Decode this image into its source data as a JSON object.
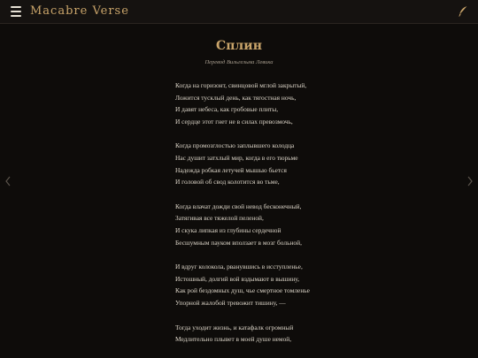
{
  "header": {
    "brand": "Macabre Verse",
    "menu_icon": "hamburger-menu-icon",
    "write_icon": "quill-icon"
  },
  "poem": {
    "title": "Сплин",
    "subtitle": "Перевод Вильгельма Левика",
    "stanzas": [
      [
        "Когда на горизонт, свинцовой мглой закрытый,",
        "Ложится тусклый день, как тягостная ночь,",
        "И давят небеса, как гробовые плиты,",
        "И сердце этот гнет не в силах превозмочь,"
      ],
      [
        "Когда промозглостью заплывшего колодца",
        "Нас душит затхлый мир, когда в его тюрьме",
        "Надежда робкая летучей мышью бьется",
        "И головой об свод колотится во тьме,"
      ],
      [
        "Когда влачат дожди свой невод бесконечный,",
        "Затягивая все тяжелой пеленой,",
        "И скука липкая из глубины сердечной",
        "Бесшумным пауком вползает в мозг больной,"
      ],
      [
        "И вдруг колокола, рванувшись в исступленье,",
        "Истошный, долгий вой вздымают в вышину,",
        "Как рой бездомных душ, чье смертное томленье",
        "Упорной жалобой тревожит тишину, —"
      ],
      [
        "Тогда уходит жизнь, и катафалк огромный",
        "Медлительно плывет в моей душе немой,"
      ]
    ]
  },
  "navigation": {
    "prev_icon": "chevron-left-icon",
    "next_icon": "chevron-right-icon"
  },
  "colors": {
    "accent": "#c9a46a",
    "background": "#0e0c0a",
    "text": "#ddd6c9"
  }
}
